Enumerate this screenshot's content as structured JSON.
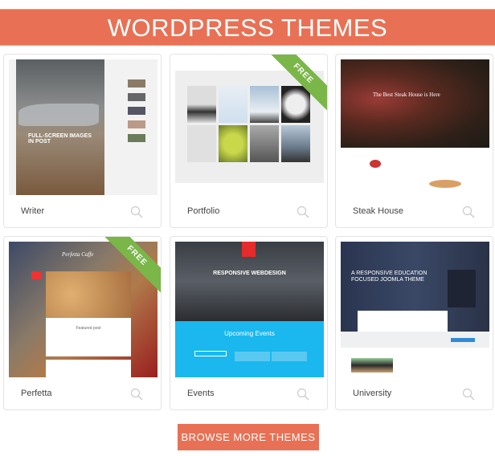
{
  "header": {
    "title": "WORDPRESS THEMES"
  },
  "themes": [
    {
      "name": "Writer",
      "free": false,
      "preview_text": "FULL-SCREEN IMAGES IN POST"
    },
    {
      "name": "Portfolio",
      "free": true,
      "preview_text": ""
    },
    {
      "name": "Steak House",
      "free": false,
      "preview_text": "The Best Steak House is Here"
    },
    {
      "name": "Perfetta",
      "free": true,
      "preview_text": "Perfetta Caffe",
      "preview_text2": "Featured post"
    },
    {
      "name": "Events",
      "free": true,
      "preview_text": "RESPONSIVE WEBDESIGN",
      "preview_text2": "Upcoming Events"
    },
    {
      "name": "University",
      "free": false,
      "preview_text": "A RESPONSIVE EDUCATION FOCUSED JOOMLA THEME"
    }
  ],
  "ribbon_label": "FREE",
  "browse_button": "BROWSE MORE THEMES",
  "colors": {
    "accent": "#e87155",
    "ribbon": "#7ab648"
  }
}
